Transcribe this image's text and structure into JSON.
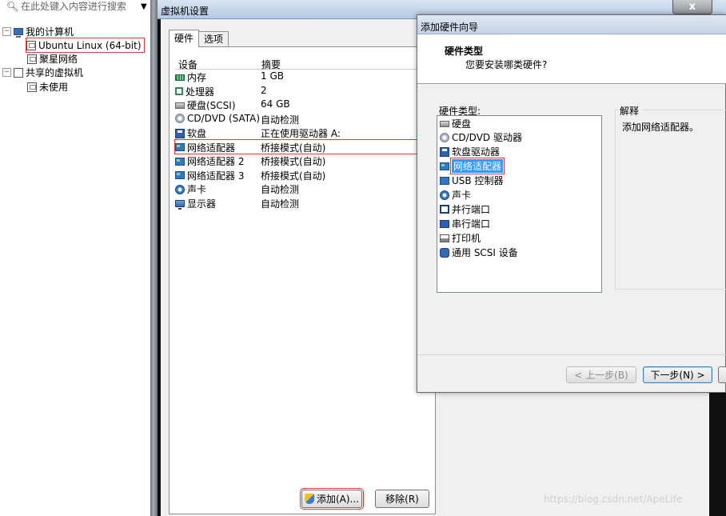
{
  "tree": {
    "search_placeholder": "在此处键入内容进行搜索",
    "items": [
      {
        "label": "我的计算机",
        "icon": "computer-icon",
        "expander": "⊟"
      },
      {
        "label": "Ubuntu Linux (64-bit)",
        "icon": "vm-icon"
      },
      {
        "label": "聚星网络",
        "icon": "vm-icon"
      },
      {
        "label": "共享的虚拟机",
        "icon": "shared-vm-icon",
        "expander": "⊟"
      },
      {
        "label": "未使用",
        "icon": "vm-icon"
      }
    ]
  },
  "vm_settings": {
    "title": "虚拟机设置",
    "close_label": "x",
    "tabs": [
      "硬件",
      "选项"
    ],
    "columns": {
      "device": "设备",
      "summary": "摘要"
    },
    "devices": [
      {
        "name": "内存",
        "summary": "1 GB",
        "icon": "memory-icon"
      },
      {
        "name": "处理器",
        "summary": "2",
        "icon": "processor-icon"
      },
      {
        "name": "硬盘(SCSI)",
        "summary": "64 GB",
        "icon": "hard-disk-icon"
      },
      {
        "name": "CD/DVD (SATA)",
        "summary": "自动检测",
        "icon": "cd-dvd-icon"
      },
      {
        "name": "软盘",
        "summary": "正在使用驱动器 A:",
        "icon": "floppy-icon"
      },
      {
        "name": "网络适配器",
        "summary": "桥接模式(自动)",
        "icon": "network-adapter-icon"
      },
      {
        "name": "网络适配器 2",
        "summary": "桥接模式(自动)",
        "icon": "network-adapter-icon"
      },
      {
        "name": "网络适配器 3",
        "summary": "桥接模式(自动)",
        "icon": "network-adapter-icon"
      },
      {
        "name": "声卡",
        "summary": "自动检测",
        "icon": "sound-card-icon"
      },
      {
        "name": "显示器",
        "summary": "自动检测",
        "icon": "display-icon"
      }
    ],
    "add_label": "添加(A)...",
    "remove_label": "移除(R)"
  },
  "wizard": {
    "title": "添加硬件向导",
    "heading": "硬件类型",
    "subheading": "您要安装哪类硬件?",
    "list_label": "硬件类型:",
    "items": [
      {
        "label": "硬盘",
        "icon": "hard-disk-icon"
      },
      {
        "label": "CD/DVD 驱动器",
        "icon": "cd-dvd-icon"
      },
      {
        "label": "软盘驱动器",
        "icon": "floppy-icon"
      },
      {
        "label": "网络适配器",
        "icon": "network-adapter-icon"
      },
      {
        "label": "USB 控制器",
        "icon": "usb-icon"
      },
      {
        "label": "声卡",
        "icon": "sound-card-icon"
      },
      {
        "label": "并行端口",
        "icon": "parallel-port-icon"
      },
      {
        "label": "串行端口",
        "icon": "serial-port-icon"
      },
      {
        "label": "打印机",
        "icon": "printer-icon"
      },
      {
        "label": "通用 SCSI 设备",
        "icon": "scsi-icon"
      }
    ],
    "description_label": "解释",
    "description": "添加网络适配器。",
    "prev_label": "< 上一步(B)",
    "next_label": "下一步(N) >"
  },
  "watermark": "https://blog.csdn.net/ApeLife",
  "colors": {
    "highlight_outline": "#e53935",
    "selection_blue": "#3399ff"
  }
}
